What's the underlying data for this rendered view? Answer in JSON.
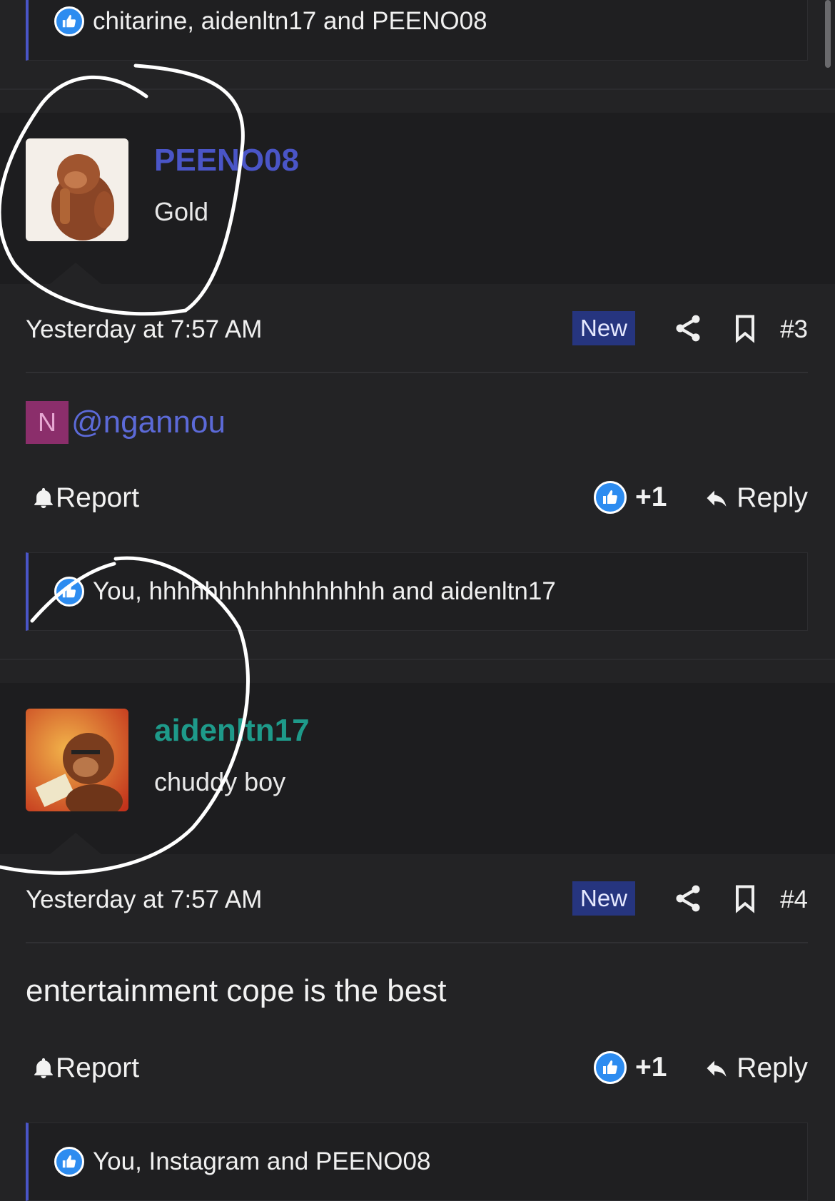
{
  "colors": {
    "background": "#232325",
    "accent_blue": "#4a55c7",
    "username_peeno": "#4a55c7",
    "username_aiden": "#1e9a8a",
    "new_badge": "#26357f",
    "like_blue": "#2d8cf0"
  },
  "top_likes": {
    "text": "chitarine, aidenltn17 and PEENO08"
  },
  "posts": [
    {
      "username": "PEENO08",
      "user_title": "Gold",
      "timestamp": "Yesterday at 7:57 AM",
      "badge": "New",
      "post_number": "#3",
      "mention_initial": "N",
      "mention": "@ngannou",
      "report_label": "Report",
      "like_count": "+1",
      "reply_label": "Reply",
      "likes_text": "You, hhhhhhhhhhhhhhhhh and aidenltn17"
    },
    {
      "username": "aidenltn17",
      "user_title": "chuddy boy",
      "timestamp": "Yesterday at 7:57 AM",
      "badge": "New",
      "post_number": "#4",
      "body": "entertainment cope is the best",
      "report_label": "Report",
      "like_count": "+1",
      "reply_label": "Reply",
      "likes_text": "You, Instagram and PEENO08"
    }
  ]
}
